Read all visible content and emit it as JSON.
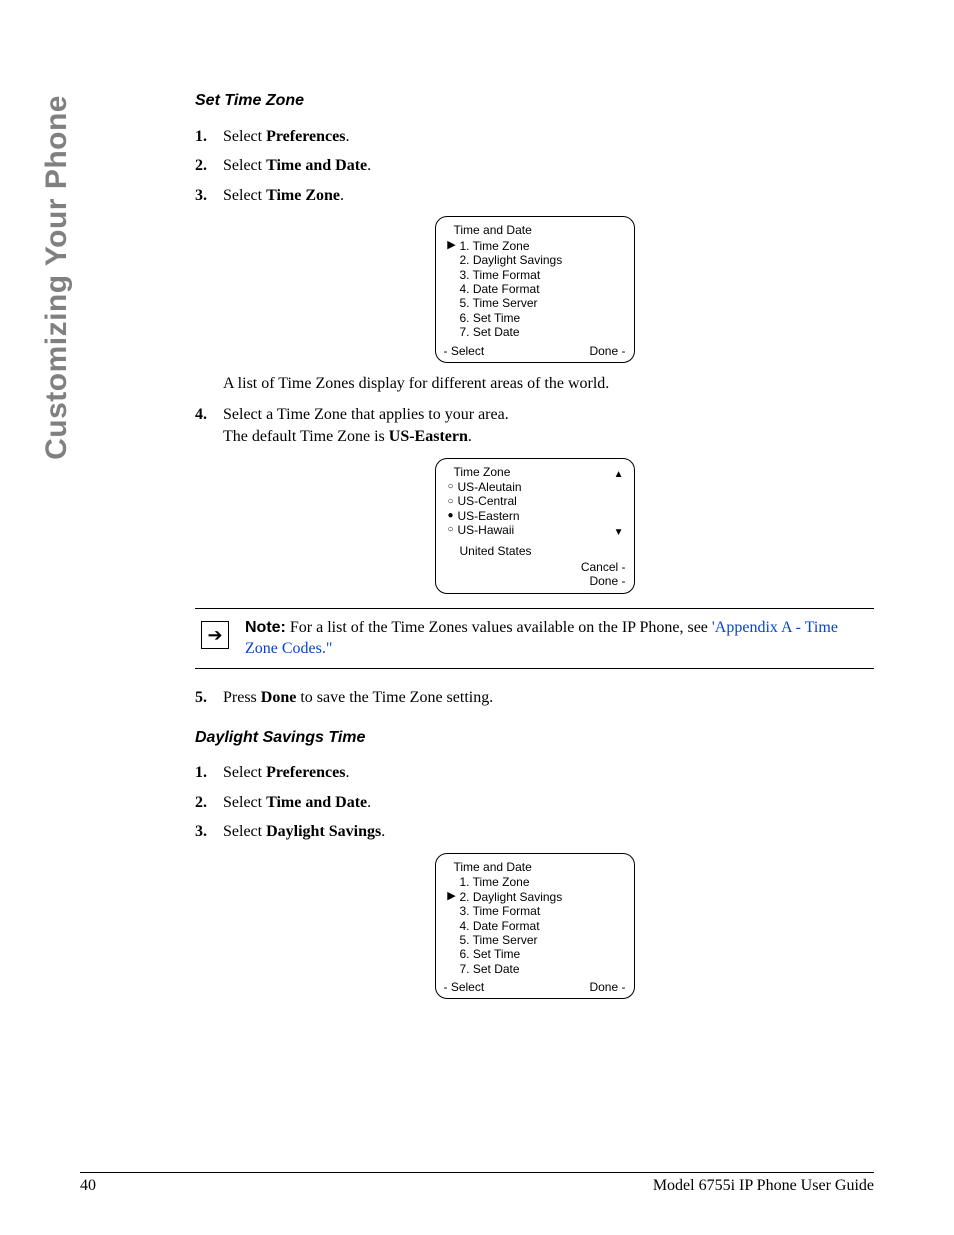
{
  "side_label": "Customizing Your Phone",
  "section1": {
    "heading": "Set Time Zone",
    "steps": {
      "s1": {
        "num": "1.",
        "pre": "Select ",
        "bold": "Preferences",
        "post": "."
      },
      "s2": {
        "num": "2.",
        "pre": "Select ",
        "bold": "Time and Date",
        "post": "."
      },
      "s3": {
        "num": "3.",
        "pre": "Select ",
        "bold": "Time Zone",
        "post": "."
      },
      "s4": {
        "num": "4.",
        "line1": "Select a Time Zone that applies to your area.",
        "line2_pre": "The default Time Zone is ",
        "line2_bold": "US-Eastern",
        "line2_post": "."
      },
      "s5": {
        "num": "5.",
        "pre": "Press ",
        "bold": "Done",
        "post": " to save the Time Zone setting."
      }
    },
    "after_screen1": "A list of Time Zones display for different areas of the world."
  },
  "screen1": {
    "title": "Time and Date",
    "items": [
      "1. Time Zone",
      "2. Daylight Savings",
      "3. Time Format",
      "4. Date Format",
      "5. Time Server",
      "6. Set Time",
      "7. Set Date"
    ],
    "selected_index": 0,
    "left_soft": "- Select",
    "right_soft": "Done -"
  },
  "screen2": {
    "title": "Time Zone",
    "options": [
      {
        "label": "US-Aleutain",
        "sel": false
      },
      {
        "label": "US-Central",
        "sel": false
      },
      {
        "label": "US-Eastern",
        "sel": true
      },
      {
        "label": "US-Hawaii",
        "sel": false
      }
    ],
    "group": "United States",
    "right_soft1": "Cancel -",
    "right_soft2": "Done -"
  },
  "note": {
    "label": "Note:",
    "text_pre": " For a list of the Time Zones values available on the IP Phone, see ",
    "link": "'Appendix A - Time Zone Codes.\""
  },
  "section2": {
    "heading": "Daylight Savings Time",
    "steps": {
      "s1": {
        "num": "1.",
        "pre": "Select ",
        "bold": "Preferences",
        "post": "."
      },
      "s2": {
        "num": "2.",
        "pre": "Select ",
        "bold": "Time and Date",
        "post": "."
      },
      "s3": {
        "num": "3.",
        "pre": "Select ",
        "bold": "Daylight Savings",
        "post": "."
      }
    }
  },
  "screen3": {
    "title": "Time and Date",
    "items": [
      "1. Time Zone",
      "2. Daylight Savings",
      "3. Time Format",
      "4. Date Format",
      "5. Time Server",
      "6. Set Time",
      "7. Set Date"
    ],
    "selected_index": 1,
    "left_soft": "- Select",
    "right_soft": "Done -"
  },
  "footer": {
    "page": "40",
    "title": "Model 6755i IP Phone User Guide"
  }
}
